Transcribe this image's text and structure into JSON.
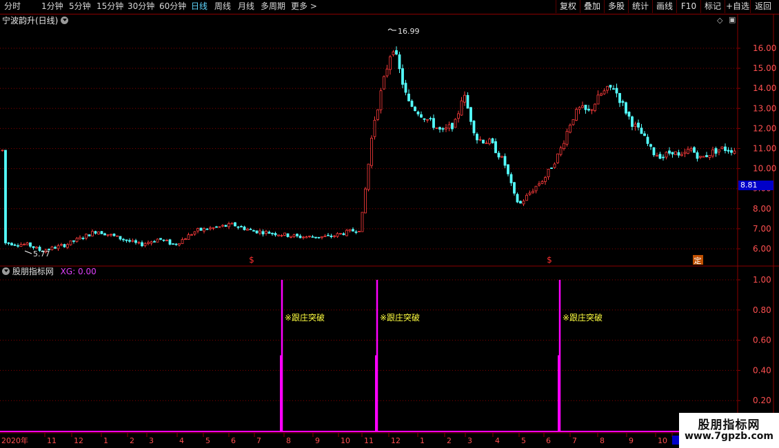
{
  "toolbar": {
    "period_tabs": [
      "分时",
      "1分钟",
      "5分钟",
      "15分钟",
      "30分钟",
      "60分钟",
      "日线",
      "周线",
      "月线",
      "多周期",
      "更多 >"
    ],
    "active_tab": "日线",
    "right_buttons": [
      "复权",
      "叠加",
      "多股",
      "统计",
      "画线",
      "F10",
      "标记",
      "+自选",
      "返回"
    ]
  },
  "stock": {
    "name": "宁波韵升(日线)"
  },
  "price_axis": {
    "ticks": [
      "16.00",
      "15.00",
      "14.00",
      "13.00",
      "12.00",
      "11.00",
      "10.00",
      "9.00",
      "8.00",
      "7.00",
      "6.00"
    ],
    "current_price": "8.81"
  },
  "chart_labels": {
    "high": "16.99",
    "low": "5.77",
    "s_marker": "$",
    "ding_marker": "定"
  },
  "indicator": {
    "name": "股朋指标网",
    "xg_label": "XG: 0.00",
    "ticks": [
      "1.00",
      "0.80",
      "0.60",
      "0.40",
      "0.20"
    ],
    "signal_text": "※跟庄突破"
  },
  "dates": [
    "2020年",
    "11",
    "12",
    "1",
    "2",
    "3",
    "4",
    "5",
    "6",
    "7",
    "8",
    "9",
    "10",
    "11",
    "12",
    "1",
    "2",
    "3",
    "4",
    "5",
    "6",
    "7",
    "8",
    "9",
    "10",
    "20"
  ],
  "watermark": {
    "title": "股朋指标网",
    "url": "www.7gpzb.com"
  },
  "colors": {
    "up": "#ff3c3c",
    "down": "#54ffff",
    "signal": "#ff00ff",
    "grid": "#8b0000",
    "annotation": "#ffff40"
  },
  "chart_data": {
    "type": "candlestick",
    "title": "宁波韵升(日线)",
    "ylim": [
      5.5,
      17.2
    ],
    "key_points": [
      {
        "label": "low",
        "value": 5.77
      },
      {
        "label": "high",
        "value": 16.99
      }
    ],
    "current_price": 8.81,
    "indicator": {
      "name": "XG",
      "value": 0.0,
      "ylim": [
        0,
        1.05
      ],
      "signal_count": 3,
      "signal_value": 1.0
    }
  }
}
